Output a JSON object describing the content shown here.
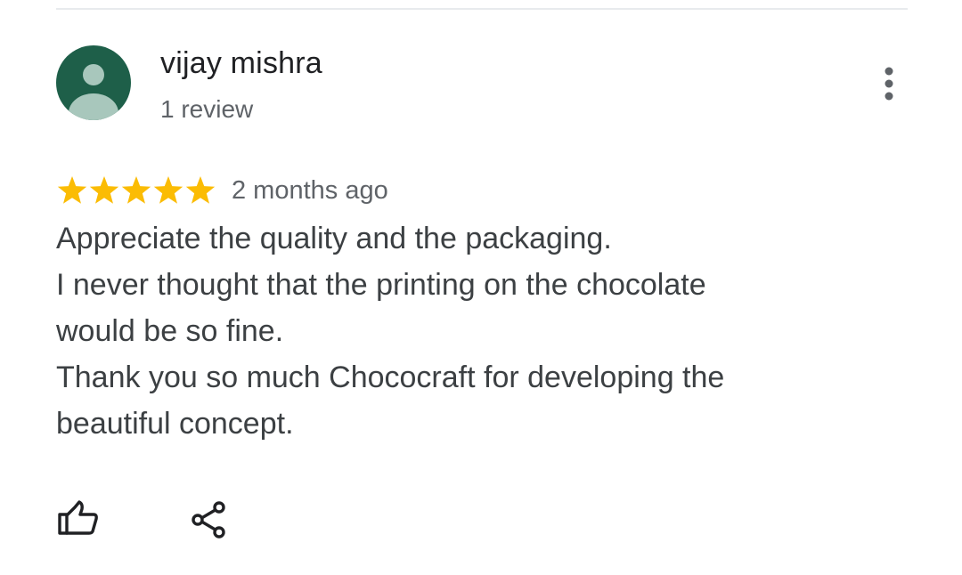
{
  "review": {
    "reviewer_name": "vijay mishra",
    "reviewer_review_count": "1 review",
    "rating": 5,
    "rating_max": 5,
    "date": "2 months ago",
    "text_lines": [
      "Appreciate the quality and the packaging.",
      "I never thought that the printing on the chocolate",
      "would be so fine.",
      "Thank you so much Chococraft for developing the",
      "beautiful concept."
    ]
  },
  "icons": {
    "avatar": "person-icon",
    "more": "more-vert-icon",
    "star": "star-icon",
    "like": "thumb-up-icon",
    "share": "share-icon"
  },
  "colors": {
    "avatar_background": "#1e5f49",
    "avatar_figure": "#a8c7bc",
    "star": "#fbbc04",
    "name_text": "#202124",
    "secondary_text": "#5f6368",
    "body_text": "#3c4043",
    "divider": "#e8eaed"
  }
}
